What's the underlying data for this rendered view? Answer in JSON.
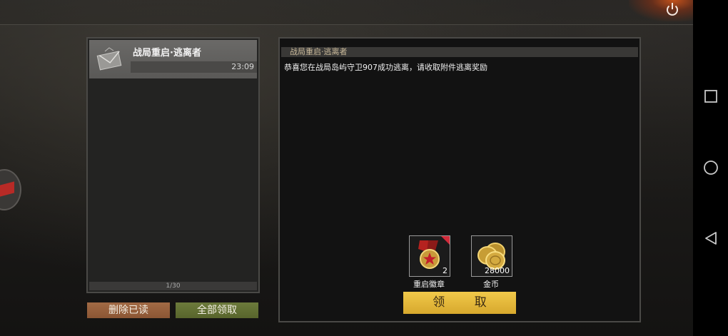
{
  "mail_list": {
    "items": [
      {
        "title": "战局重启·逃离者",
        "time": "23:09"
      }
    ],
    "page": "1/30"
  },
  "buttons": {
    "delete_read": "删除已读",
    "claim_all": "全部领取",
    "claim": "领 取"
  },
  "detail": {
    "title": "战局重启·逃离者",
    "body": "恭喜您在战局岛屿守卫907成功逃离，请收取附件逃离奖励"
  },
  "rewards": [
    {
      "name": "重启徽章",
      "count": "2",
      "icon": "medal-icon"
    },
    {
      "name": "金币",
      "count": "28000",
      "icon": "gold-coins-icon"
    }
  ],
  "colors": {
    "claim_button": "#e6bb3c",
    "delete_button": "#9a6240",
    "claim_all_button": "#66743a",
    "accent_power": "#c4521b"
  },
  "nav": {
    "icons": [
      "recent-apps-icon",
      "home-icon",
      "back-icon"
    ]
  }
}
